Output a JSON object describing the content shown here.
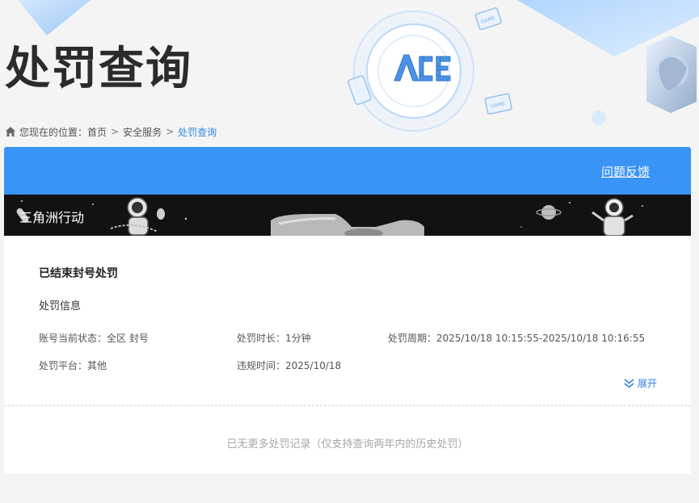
{
  "page": {
    "title": "处罚查询",
    "logo_text": "ACE",
    "game_badge_text": "GAME"
  },
  "breadcrumb": {
    "prefix": "您现在的位置：",
    "items": [
      {
        "label": "首页"
      },
      {
        "label": "安全服务"
      },
      {
        "label": "处罚查询"
      }
    ],
    "separator": ">"
  },
  "card": {
    "feedback_label": "问题反馈",
    "game_name": "三角洲行动",
    "record_title": "已结束封号处罚",
    "section_title": "处罚信息",
    "info": {
      "account_status_label": "账号当前状态：",
      "account_status_value": "全区 封号",
      "duration_label": "处罚时长：",
      "duration_value": "1分钟",
      "period_label": "处罚周期：",
      "period_value": "2025/10/18 10:15:55-2025/10/18 10:16:55",
      "platform_label": "处罚平台：",
      "platform_value": "其他",
      "violation_time_label": "违规时间：",
      "violation_time_value": "2025/10/18"
    },
    "expand_label": "展开",
    "no_more_text": "已无更多处罚记录（仅支持查询两年内的历史处罚）"
  },
  "colors": {
    "accent": "#3994f6",
    "link_current": "#2f8ce8",
    "expand": "#2f7fe0",
    "banner_bg": "#121212",
    "title": "#2b2b2b"
  },
  "icons": {
    "home": "home-icon",
    "expand": "chevron-double-down-icon",
    "logo": "ace-logo"
  }
}
